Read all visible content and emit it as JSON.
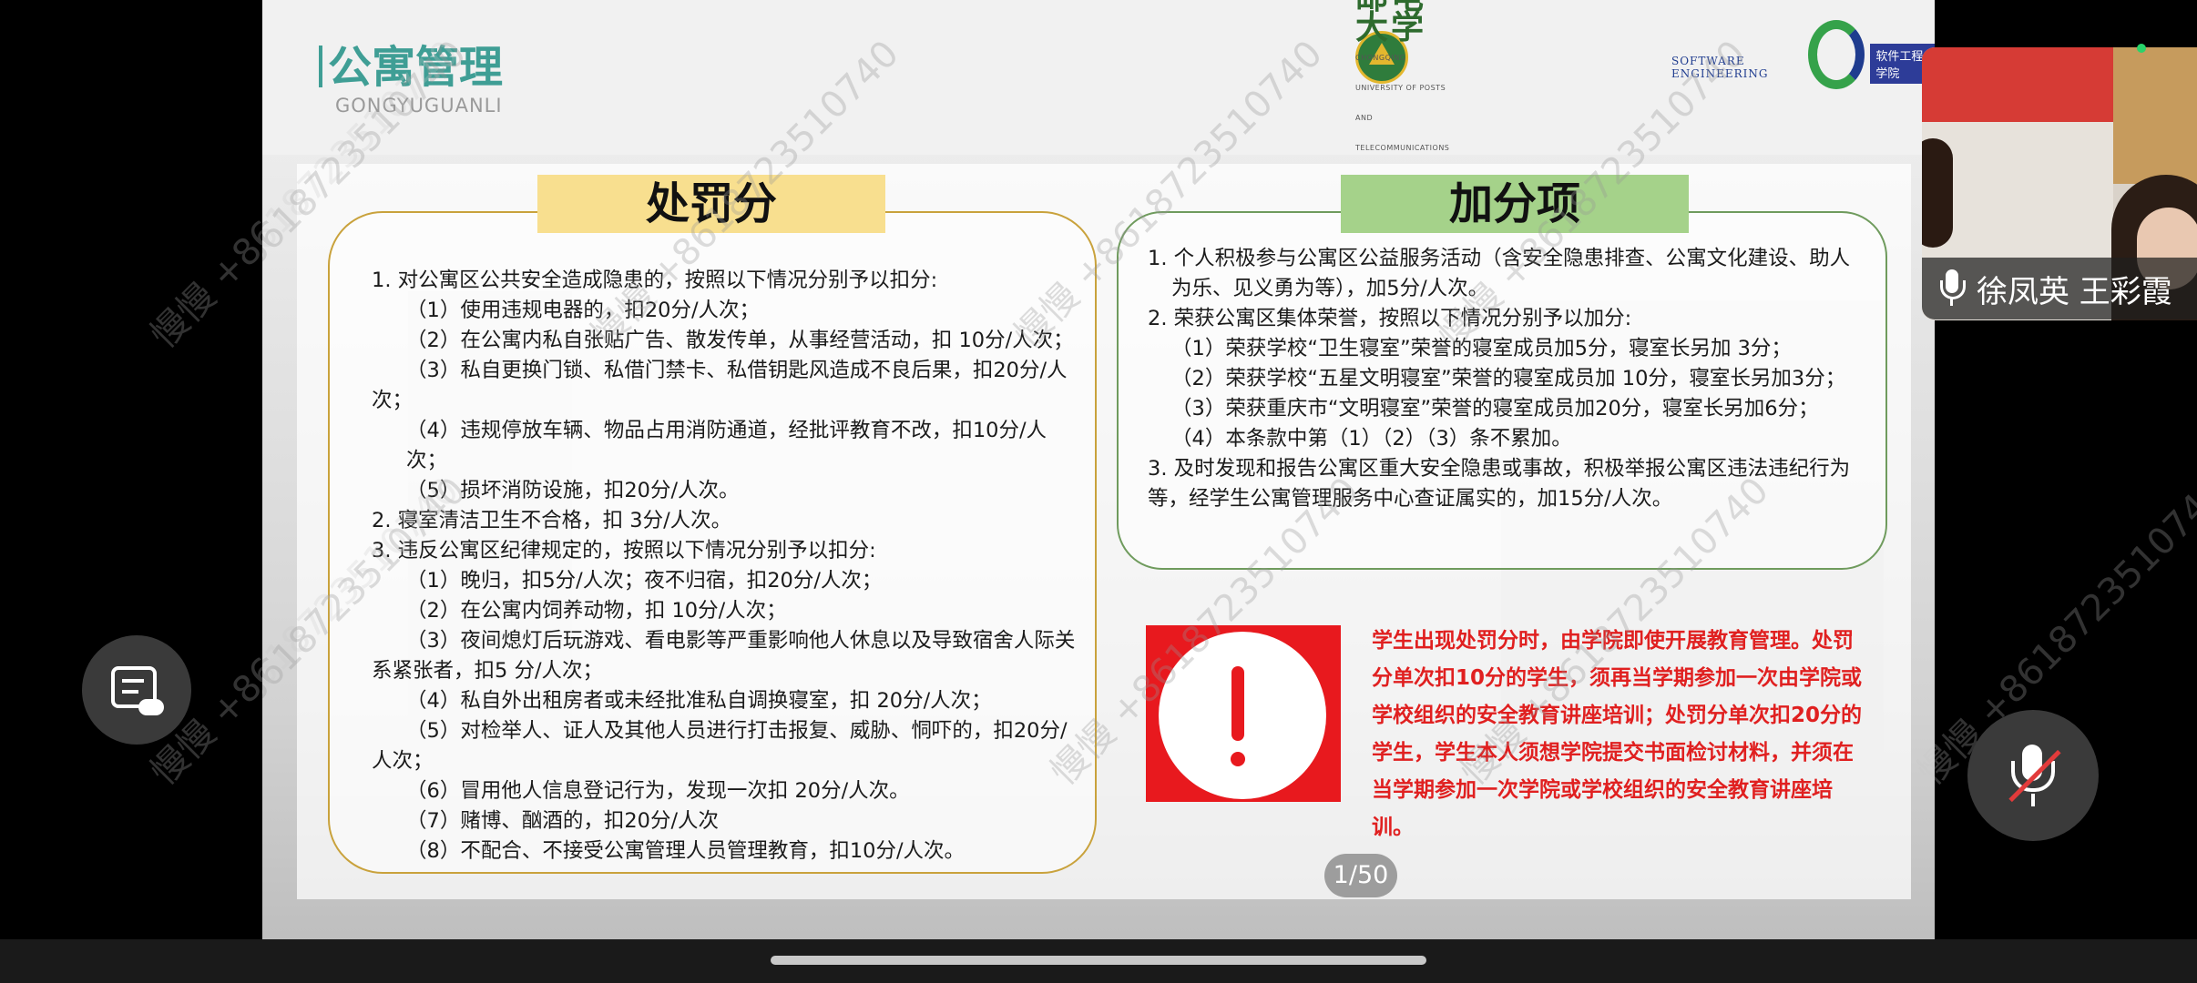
{
  "slide": {
    "title": "公寓管理",
    "subtitle": "GONGYUGUANLI",
    "logo_school_cn": "重庆邮电大学",
    "logo_school_en": "CHONGQING UNIVERSITY OF POSTS AND TELECOMMUNICATIONS",
    "logo_dept_en": "SOFTWARE  ENGINEERING",
    "logo_dept_cn": "软件工程学院",
    "penalty_title": "处罚分",
    "bonus_title": "加分项",
    "penalty_lines": [
      "1. 对公寓区公共安全造成隐患的，按照以下情况分别予以扣分:",
      "（1）使用违规电器的，扣20分/人次；",
      "（2）在公寓内私自张贴广告、散发传单，从事经营活动，扣 10分/人次；",
      "（3）私自更换门锁、私借门禁卡、私借钥匙风造成不良后果，扣20分/人次；",
      "（4）违规停放车辆、物品占用消防通道，经批评教育不改，扣10分/人次；",
      "（5）损坏消防设施，扣20分/人次。",
      "2. 寝室清洁卫生不合格，扣 3分/人次。",
      "3. 违反公寓区纪律规定的，按照以下情况分别予以扣分:",
      "（1）晚归，扣5分/人次；夜不归宿，扣20分/人次；",
      "（2）在公寓内饲养动物，扣 10分/人次；",
      "（3）夜间熄灯后玩游戏、看电影等严重影响他人休息以及导致宿舍人际关系紧张者，扣5 分/人次；",
      "（4）私自外出租房者或未经批准私自调换寝室，扣 20分/人次；",
      "（5）对检举人、证人及其他人员进行打击报复、威胁、恫吓的，扣20分/人次；",
      "（6）冒用他人信息登记行为，发现一次扣 20分/人次。",
      "（7）赌博、酗酒的，扣20分/人次",
      "（8）不配合、不接受公寓管理人员管理教育，扣10分/人次。"
    ],
    "bonus_lines": [
      "1.  个人积极参与公寓区公益服务活动（含安全隐患排查、公寓文化建设、助人",
      "为乐、见义勇为等），加5分/人次。",
      "2. 荣获公寓区集体荣誉，按照以下情况分别予以加分:",
      "（1）荣获学校“卫生寝室”荣誉的寝室成员加5分，寝室长另加 3分；",
      "（2）荣获学校“五星文明寝室”荣誉的寝室成员加 10分，寝室长另加3分；",
      "（3）荣获重庆市“文明寝室”荣誉的寝室成员加20分，寝室长另加6分；",
      "（4）本条款中第（1）（2）（3）条不累加。",
      "3. 及时发现和报告公寓区重大安全隐患或事故，积极举报公寓区违法违纪行为等，经学生公寓管理服务中心查证属实的，加15分/人次。"
    ],
    "warning_text": "学生出现处罚分时，由学院即使开展教育管理。处罚分单次扣10分的学生，须再当学期参加一次由学院或学校组织的安全教育讲座培训；处罚分单次扣20分的学生，学生本人须想学院提交书面检讨材料，并须在当学期参加一次学院或学校组织的安全教育讲座培训。",
    "page_counter": "1/50",
    "watermark": "慢慢 +8618723510740"
  },
  "video": {
    "names": "徐凤英 王彩霞"
  },
  "colors": {
    "title_teal": "#3f9e95",
    "penalty_yellow": "#f8df8f",
    "bonus_green": "#a5d28a",
    "warning_red": "#e8191e"
  },
  "icons": {
    "left_fab": "notes-icon",
    "right_fab": "mic-off-icon",
    "name_mic": "mic-icon"
  }
}
